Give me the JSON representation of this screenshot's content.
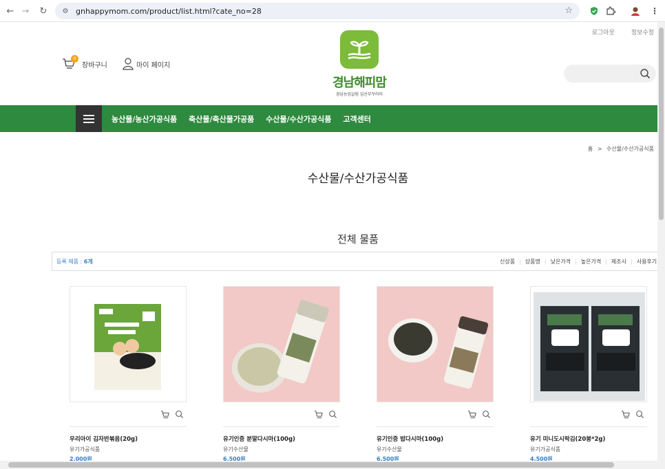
{
  "browser": {
    "url": "gnhappymom.com/product/list.html?cate_no=28"
  },
  "header": {
    "top_links": [
      "로그아웃",
      "정보수정"
    ],
    "cart_label": "장바구니",
    "cart_count": "0",
    "mypage_label": "마이 페이지",
    "logo_title": "경남해피맘",
    "logo_subtitle": "경남농업살림 임산부꾸러미",
    "search_placeholder": ""
  },
  "nav": {
    "items": [
      "농산물/농산가공식품",
      "축산물/축산물가공품",
      "수산물/수산가공식품",
      "고객센터"
    ]
  },
  "breadcrumb": {
    "home": "홈",
    "separator": ">",
    "current": "수산물/수산가공식품"
  },
  "page_title": "수산물/수산가공식품",
  "section_title": "전체 물품",
  "list": {
    "count_label": "등록 제품 :",
    "count_value": "6개",
    "sorts": [
      "신상품",
      "상품명",
      "낮은가격",
      "높은가격",
      "제조사",
      "사용후기"
    ]
  },
  "products": [
    {
      "name": "우리아이 김자반볶음(20g)",
      "category": "유기가공식품",
      "price": "2,000원",
      "image": "laver-flakes-pouch"
    },
    {
      "name": "유기인증 분말다시마(100g)",
      "category": "유기수산물",
      "price": "6,500원",
      "image": "kelp-powder-bottle"
    },
    {
      "name": "유기인증 밥다시마(100g)",
      "category": "유기수산물",
      "price": "6,500원",
      "image": "kelp-flakes-bottle"
    },
    {
      "name": "유기 미니도시락김(20봉*2g)",
      "category": "유기가공식품",
      "price": "4,500원",
      "image": "seaweed-snack-packs"
    }
  ],
  "colors": {
    "nav_green": "#2d8a3e",
    "logo_green": "#7dbb3a",
    "price_blue": "#2f80c8",
    "badge_orange": "#f2a51c"
  }
}
